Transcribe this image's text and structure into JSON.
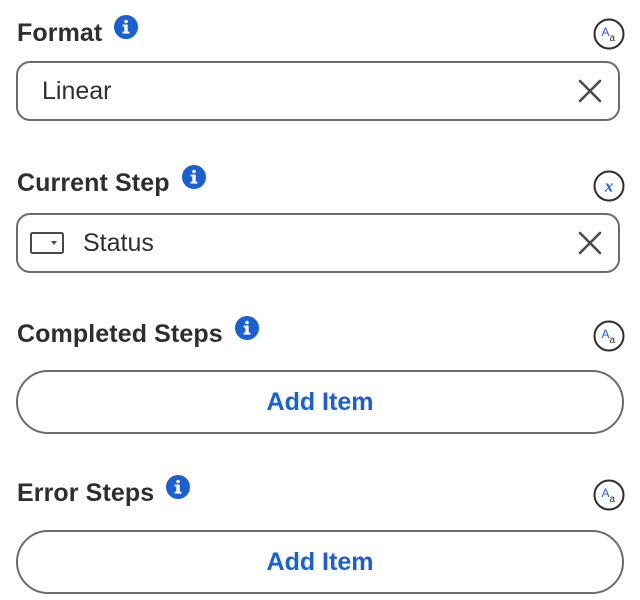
{
  "format": {
    "label": "Format",
    "value": "Linear",
    "info_icon": "info-icon",
    "mode_icon": "text-mode-icon",
    "mode_glyph_upper": "A",
    "mode_glyph_lower": "a",
    "clear_icon": "close-icon"
  },
  "current_step": {
    "label": "Current Step",
    "value": "Status",
    "info_icon": "info-icon",
    "mode_icon": "variable-mode-icon",
    "mode_glyph": "x",
    "field_icon": "dropdown-field-icon",
    "clear_icon": "close-icon"
  },
  "completed_steps": {
    "label": "Completed Steps",
    "button_label": "Add Item",
    "info_icon": "info-icon",
    "mode_icon": "text-mode-icon",
    "mode_glyph_upper": "A",
    "mode_glyph_lower": "a"
  },
  "error_steps": {
    "label": "Error Steps",
    "button_label": "Add Item",
    "info_icon": "info-icon",
    "mode_icon": "text-mode-icon",
    "mode_glyph_upper": "A",
    "mode_glyph_lower": "a"
  },
  "colors": {
    "accent": "#1a5fd6",
    "text": "#2e2e2e",
    "border": "#6b6b6b"
  }
}
